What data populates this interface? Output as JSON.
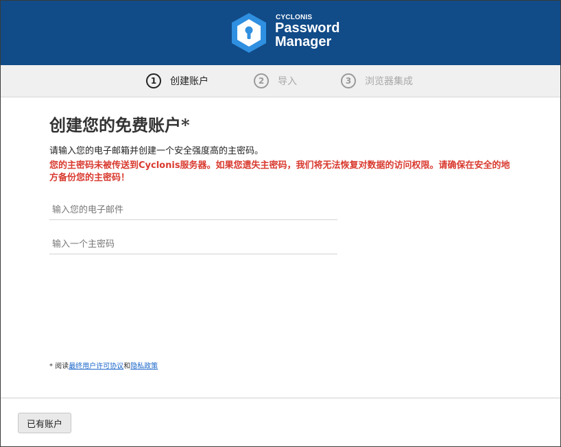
{
  "colors": {
    "header_bg": "#114b88",
    "logo_blue": "#2f8fe0",
    "warning_red": "#d93a2f",
    "link_blue": "#1a66c9"
  },
  "brand": {
    "company": "CYCLONIS",
    "product_line1": "Password",
    "product_line2": "Manager",
    "logo_icon": "keyhole-hexagon-icon"
  },
  "steps": [
    {
      "number": "1",
      "label": "创建账户",
      "active": true
    },
    {
      "number": "2",
      "label": "导入",
      "active": false
    },
    {
      "number": "3",
      "label": "浏览器集成",
      "active": false
    }
  ],
  "form": {
    "title": "创建您的免费账户*",
    "description": "请输入您的电子邮箱并创建一个安全强度高的主密码。",
    "warning": "您的主密码未被传送到Cyclonis服务器。如果您遗失主密码，我们将无法恢复对数据的访问权限。请确保在安全的地方备份您的主密码！",
    "email": {
      "value": "",
      "placeholder": "输入您的电子邮件"
    },
    "password": {
      "value": "",
      "placeholder": "输入一个主密码"
    }
  },
  "agreement": {
    "prefix": "* 阅读",
    "eula_link": "最终用户许可协议",
    "conjunction": "和",
    "privacy_link": "隐私政策"
  },
  "footer": {
    "have_account_label": "已有账户"
  }
}
